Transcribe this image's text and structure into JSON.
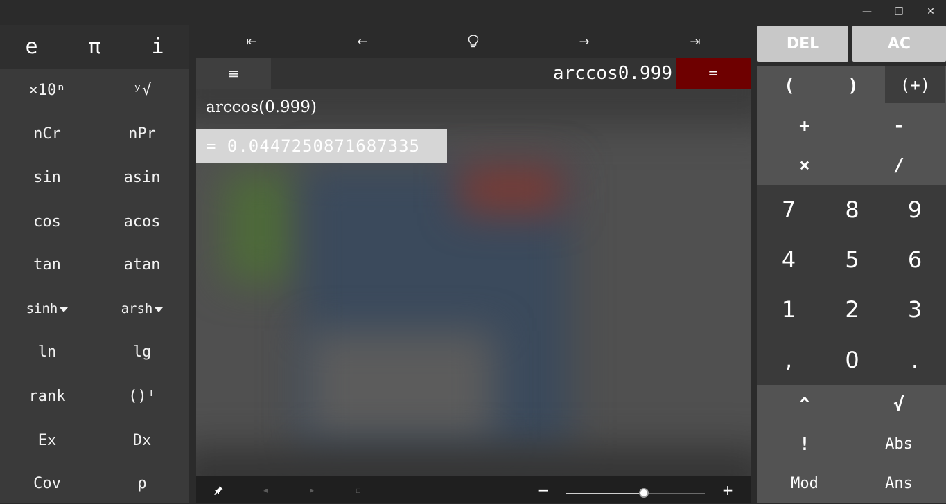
{
  "window": {
    "minimize_label": "—",
    "restore_label": "❐",
    "close_label": "✕"
  },
  "constants": [
    "e",
    "π",
    "i"
  ],
  "functions": [
    [
      "×10ⁿ",
      "ʸ√"
    ],
    [
      "nCr",
      "nPr"
    ],
    [
      "sin",
      "asin"
    ],
    [
      "cos",
      "acos"
    ],
    [
      "tan",
      "atan"
    ],
    [
      "sinh",
      "arsh"
    ],
    [
      "ln",
      "lg"
    ],
    [
      "rank",
      "()ᵀ"
    ],
    [
      "Ex",
      "Dx"
    ],
    [
      "Cov",
      "ρ"
    ]
  ],
  "toolbar": {
    "first_label": "⇤",
    "back_label": "←",
    "hint_icon": "lightbulb-icon",
    "forward_label": "→",
    "last_label": "⇥"
  },
  "input": {
    "menu_label": "≡",
    "expression": "arccos0.999",
    "equals_label": "="
  },
  "history": {
    "expression": "arccos(0.999)",
    "result": "= 0.0447250871687335"
  },
  "bottom": {
    "pin_icon": "pin-icon",
    "zoom_out_label": "−",
    "zoom_in_label": "+",
    "zoom_level": 0.56
  },
  "keypad": {
    "del_label": "DEL",
    "ac_label": "AC",
    "ops": [
      "(",
      ")",
      "(+)",
      "+",
      "-",
      "×",
      "/"
    ],
    "digits": [
      [
        "7",
        "8",
        "9"
      ],
      [
        "4",
        "5",
        "6"
      ],
      [
        "1",
        "2",
        "3"
      ],
      [
        ",",
        "0",
        "."
      ]
    ],
    "funcs": [
      "^",
      "√",
      "!",
      "Abs",
      "Mod",
      "Ans"
    ]
  },
  "colors": {
    "equals_button": "#6e0000",
    "result_highlight": "#d6d6d6",
    "top_buttons": "#c8c8c8"
  }
}
